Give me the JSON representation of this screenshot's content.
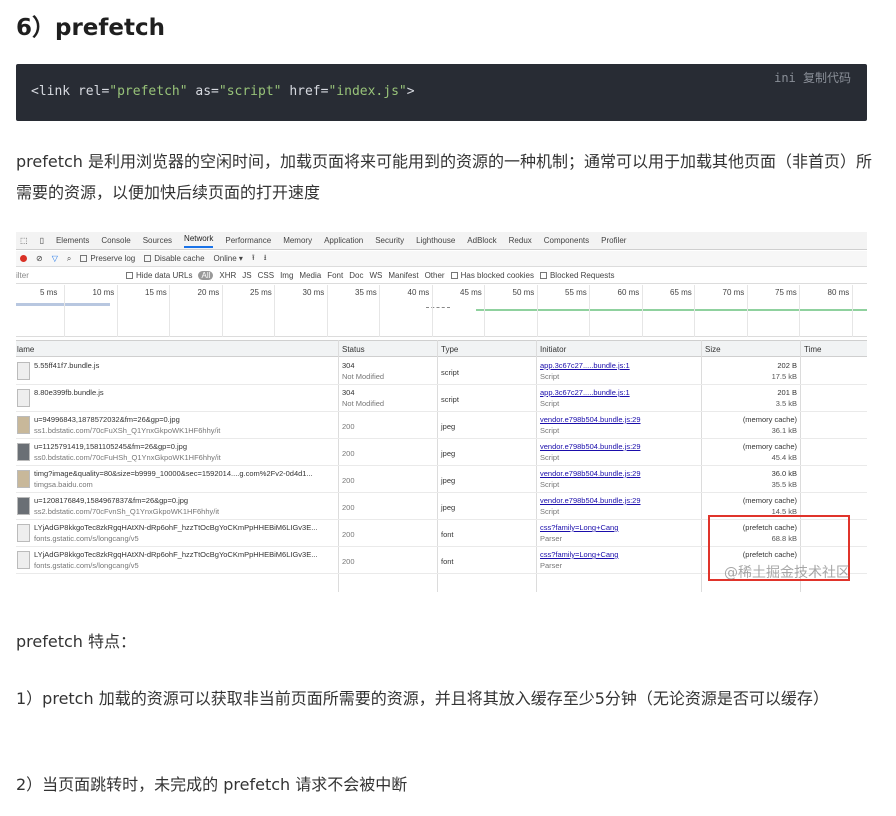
{
  "heading": "6）prefetch",
  "code": {
    "lang_label": "ini 复制代码",
    "line_prefix": "<link rel=",
    "rel_value": "\"prefetch\"",
    "as_attr": " as=",
    "as_value": "\"script\"",
    "href_attr": " href=",
    "href_value": "\"index.js\"",
    "line_suffix": ">"
  },
  "intro_paragraph": "prefetch 是利用浏览器的空闲时间，加载页面将来可能用到的资源的一种机制；通常可以用于加载其他页面（非首页）所需要的资源，以便加快后续页面的打开速度",
  "devtools": {
    "tabs": [
      "Elements",
      "Console",
      "Sources",
      "Network",
      "Performance",
      "Memory",
      "Application",
      "Security",
      "Lighthouse",
      "AdBlock",
      "Redux",
      "Components",
      "Profiler"
    ],
    "active_tab": "Network",
    "toolbar": {
      "preserve_log": "Preserve log",
      "disable_cache": "Disable cache",
      "throttle": "Online"
    },
    "filter": {
      "placeholder": "ilter",
      "hide_data_urls": "Hide data URLs",
      "all": "All",
      "types": [
        "XHR",
        "JS",
        "CSS",
        "Img",
        "Media",
        "Font",
        "Doc",
        "WS",
        "Manifest",
        "Other"
      ],
      "has_blocked_cookies": "Has blocked cookies",
      "blocked_requests": "Blocked Requests"
    },
    "timeline_ticks": [
      "5 ms",
      "10 ms",
      "15 ms",
      "20 ms",
      "25 ms",
      "30 ms",
      "35 ms",
      "40 ms",
      "45 ms",
      "50 ms",
      "55 ms",
      "60 ms",
      "65 ms",
      "70 ms",
      "75 ms",
      "80 ms"
    ],
    "columns": [
      "lame",
      "Status",
      "Type",
      "Initiator",
      "Size",
      "Time"
    ],
    "rows": [
      {
        "name": "5.55ff41f7.bundle.js",
        "domain": "",
        "status": "304",
        "status_text": "Not Modified",
        "type": "script",
        "initiator": "app.3c67c27.....bundle.js:1",
        "initiator_type": "Script",
        "size": "202 B",
        "size2": "17.5 kB"
      },
      {
        "name": "8.80e399fb.bundle.js",
        "domain": "",
        "status": "304",
        "status_text": "Not Modified",
        "type": "script",
        "initiator": "app.3c67c27.....bundle.js:1",
        "initiator_type": "Script",
        "size": "201 B",
        "size2": "3.5 kB"
      },
      {
        "name": "u=94996843,1878572032&fm=26&gp=0.jpg",
        "domain": "ss1.bdstatic.com/70cFuXSh_Q1YnxGkpoWK1HF6hhy/it",
        "status": "200",
        "status_text": "",
        "type": "jpeg",
        "initiator": "vendor.e798b504.bundle.js:29",
        "initiator_type": "Script",
        "size": "(memory cache)",
        "size2": "36.1 kB"
      },
      {
        "name": "u=1125791419,1581105245&fm=26&gp=0.jpg",
        "domain": "ss0.bdstatic.com/70cFuHSh_Q1YnxGkpoWK1HF6hhy/it",
        "status": "200",
        "status_text": "",
        "type": "jpeg",
        "initiator": "vendor.e798b504.bundle.js:29",
        "initiator_type": "Script",
        "size": "(memory cache)",
        "size2": "45.4 kB"
      },
      {
        "name": "timg?image&quality=80&size=b9999_10000&sec=1592014....g.com%2Fv2-0d4d1...",
        "domain": "timgsa.baidu.com",
        "status": "200",
        "status_text": "",
        "type": "jpeg",
        "initiator": "vendor.e798b504.bundle.js:29",
        "initiator_type": "Script",
        "size": "36.0 kB",
        "size2": "35.5 kB"
      },
      {
        "name": "u=1208176849,1584967837&fm=26&gp=0.jpg",
        "domain": "ss2.bdstatic.com/70cFvnSh_Q1YnxGkpoWK1HF6hhy/it",
        "status": "200",
        "status_text": "",
        "type": "jpeg",
        "initiator": "vendor.e798b504.bundle.js:29",
        "initiator_type": "Script",
        "size": "(memory cache)",
        "size2": "14.5 kB"
      },
      {
        "name": "LYjAdGP8kkgoTec8zkRgqHAtXN-dRp6ohF_hzzTtOcBgYoCKmPpHHEBiM6LIGv3E...",
        "domain": "fonts.gstatic.com/s/longcang/v5",
        "status": "200",
        "status_text": "",
        "type": "font",
        "initiator": "css?family=Long+Cang",
        "initiator_type": "Parser",
        "size": "(prefetch cache)",
        "size2": "68.8 kB"
      },
      {
        "name": "LYjAdGP8kkgoTec8zkRgqHAtXN-dRp6ohF_hzzTtOcBgYoCKmPpHHEBiM6LIGv3E...",
        "domain": "fonts.gstatic.com/s/longcang/v5",
        "status": "200",
        "status_text": "",
        "type": "font",
        "initiator": "css?family=Long+Cang",
        "initiator_type": "Parser",
        "size": "(prefetch cache)",
        "size2": ""
      }
    ],
    "watermark": "@稀土掘金技术社区"
  },
  "features_title": "prefetch 特点：",
  "feature_1": "1）pretch 加载的资源可以获取非当前页面所需要的资源，并且将其放入缓存至少5分钟（无论资源是否可以缓存）",
  "feature_2": "2）当页面跳转时，未完成的 prefetch 请求不会被中断",
  "colors": {
    "code_bg": "#282c34",
    "code_string": "#98c379",
    "highlight": "#e0342b",
    "active_tab": "#1a73e8"
  }
}
